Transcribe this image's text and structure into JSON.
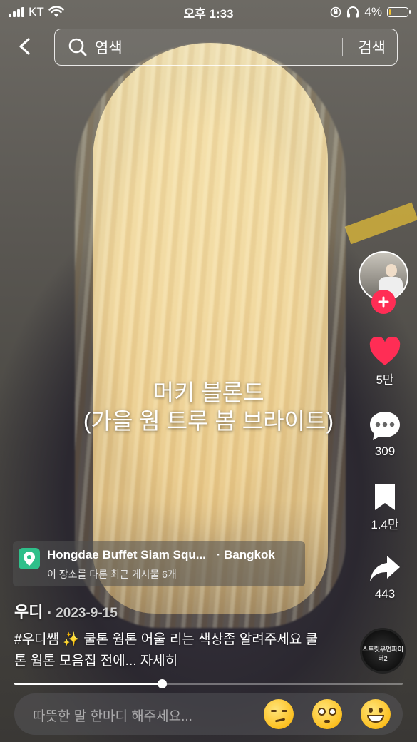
{
  "status_bar": {
    "carrier": "KT",
    "time": "오후 1:33",
    "battery": "4%",
    "battery_level": 0.04
  },
  "search": {
    "query": "염색",
    "submit_label": "검색"
  },
  "caption": {
    "line1": "머키 블론드",
    "line2": "(가을 웜 트루 봄 브라이트)"
  },
  "rail": {
    "likes": "5만",
    "comments": "309",
    "saves": "1.4만",
    "shares": "443",
    "disc_label": "스트릿우먼파이터2"
  },
  "location": {
    "name": "Hongdae Buffet Siam Squ...",
    "city": "· Bangkok",
    "subtitle": "이 장소를 다룬 최근 게시물 6개"
  },
  "post": {
    "author": "우디",
    "date": "· 2023-9-15",
    "description": "#우디쌤 ✨ 쿨톤 웜톤 어울 리는 색상좀 알려주세요  쿨톤 웜톤 모음집  전에... 자세히"
  },
  "progress": 0.38,
  "comment": {
    "placeholder": "따뜻한 말 한마디 해주세요..."
  },
  "colors": {
    "like": "#ff2d55",
    "location_pin": "#2fbf8a"
  }
}
